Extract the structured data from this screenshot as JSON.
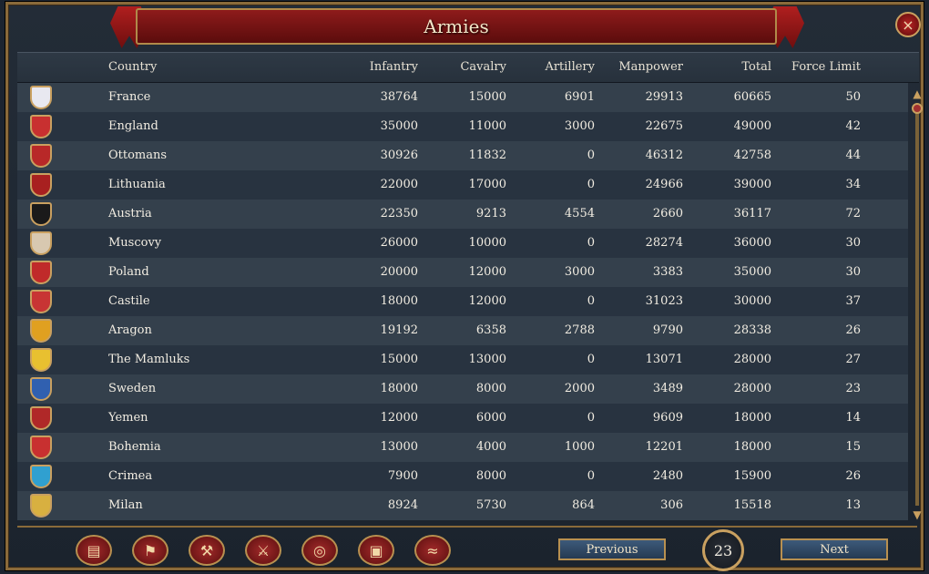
{
  "window": {
    "title": "Armies",
    "close_icon": "×"
  },
  "columns": [
    "Country",
    "Infantry",
    "Cavalry",
    "Artillery",
    "Manpower",
    "Total",
    "Force Limit"
  ],
  "rows": [
    {
      "country": "France",
      "infantry": "38764",
      "cavalry": "15000",
      "artillery": "6901",
      "manpower": "29913",
      "total": "60665",
      "force_limit": "50",
      "flag": "#e8e8f0"
    },
    {
      "country": "England",
      "infantry": "35000",
      "cavalry": "11000",
      "artillery": "3000",
      "manpower": "22675",
      "total": "49000",
      "force_limit": "42",
      "flag": "#c83030"
    },
    {
      "country": "Ottomans",
      "infantry": "30926",
      "cavalry": "11832",
      "artillery": "0",
      "manpower": "46312",
      "total": "42758",
      "force_limit": "44",
      "flag": "#b82828"
    },
    {
      "country": "Lithuania",
      "infantry": "22000",
      "cavalry": "17000",
      "artillery": "0",
      "manpower": "24966",
      "total": "39000",
      "force_limit": "34",
      "flag": "#a82020"
    },
    {
      "country": "Austria",
      "infantry": "22350",
      "cavalry": "9213",
      "artillery": "4554",
      "manpower": "2660",
      "total": "36117",
      "force_limit": "72",
      "flag": "#1a1a1a"
    },
    {
      "country": "Muscovy",
      "infantry": "26000",
      "cavalry": "10000",
      "artillery": "0",
      "manpower": "28274",
      "total": "36000",
      "force_limit": "30",
      "flag": "#d8c8b0"
    },
    {
      "country": "Poland",
      "infantry": "20000",
      "cavalry": "12000",
      "artillery": "3000",
      "manpower": "3383",
      "total": "35000",
      "force_limit": "30",
      "flag": "#c02a2a"
    },
    {
      "country": "Castile",
      "infantry": "18000",
      "cavalry": "12000",
      "artillery": "0",
      "manpower": "31023",
      "total": "30000",
      "force_limit": "37",
      "flag": "#c83434"
    },
    {
      "country": "Aragon",
      "infantry": "19192",
      "cavalry": "6358",
      "artillery": "2788",
      "manpower": "9790",
      "total": "28338",
      "force_limit": "26",
      "flag": "#e0a020"
    },
    {
      "country": "The Mamluks",
      "infantry": "15000",
      "cavalry": "13000",
      "artillery": "0",
      "manpower": "13071",
      "total": "28000",
      "force_limit": "27",
      "flag": "#e8c030"
    },
    {
      "country": "Sweden",
      "infantry": "18000",
      "cavalry": "8000",
      "artillery": "2000",
      "manpower": "3489",
      "total": "28000",
      "force_limit": "23",
      "flag": "#3060b0"
    },
    {
      "country": "Yemen",
      "infantry": "12000",
      "cavalry": "6000",
      "artillery": "0",
      "manpower": "9609",
      "total": "18000",
      "force_limit": "14",
      "flag": "#b02828"
    },
    {
      "country": "Bohemia",
      "infantry": "13000",
      "cavalry": "4000",
      "artillery": "1000",
      "manpower": "12201",
      "total": "18000",
      "force_limit": "15",
      "flag": "#c83030"
    },
    {
      "country": "Crimea",
      "infantry": "7900",
      "cavalry": "8000",
      "artillery": "0",
      "manpower": "2480",
      "total": "15900",
      "force_limit": "26",
      "flag": "#30a0d0"
    },
    {
      "country": "Milan",
      "infantry": "8924",
      "cavalry": "5730",
      "artillery": "864",
      "manpower": "306",
      "total": "15518",
      "force_limit": "13",
      "flag": "#d8b040"
    }
  ],
  "bottom": {
    "icons": [
      {
        "name": "ledger-icon",
        "glyph": "▤"
      },
      {
        "name": "flags-icon",
        "glyph": "⚑"
      },
      {
        "name": "production-icon",
        "glyph": "⚒"
      },
      {
        "name": "swords-icon",
        "glyph": "⚔"
      },
      {
        "name": "coins-icon",
        "glyph": "◎"
      },
      {
        "name": "trade-goods-icon",
        "glyph": "▣"
      },
      {
        "name": "handshake-icon",
        "glyph": "≈"
      }
    ],
    "previous_label": "Previous",
    "next_label": "Next",
    "page": "23"
  }
}
